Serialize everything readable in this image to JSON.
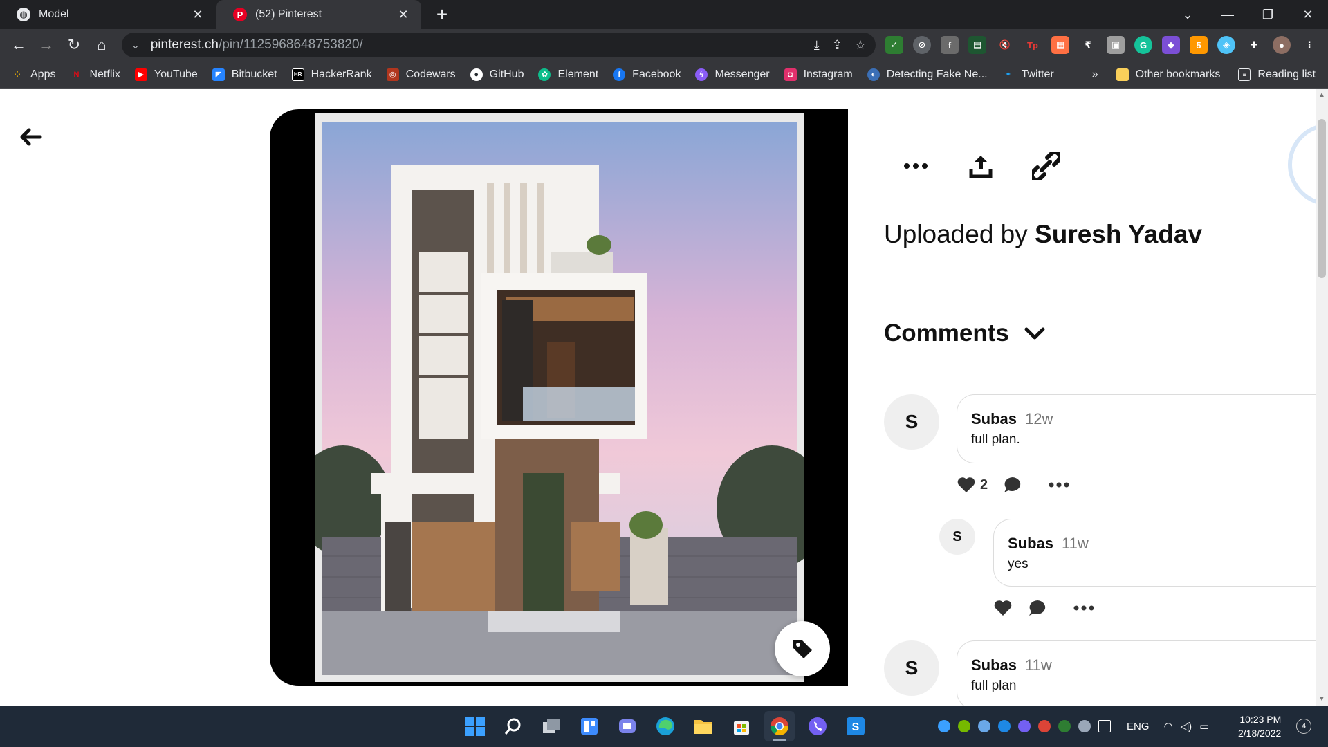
{
  "browser": {
    "tabs": [
      {
        "title": "Model",
        "active": false
      },
      {
        "title": "(52) Pinterest",
        "active": true
      }
    ],
    "address": {
      "domain": "pinterest.ch",
      "path": "/pin/1125968648753820/"
    },
    "bookmarks": [
      {
        "label": "Apps",
        "icon": "apps-grid-icon",
        "color": "#f4b400"
      },
      {
        "label": "Netflix",
        "icon": "netflix-icon",
        "color": "#e50914"
      },
      {
        "label": "YouTube",
        "icon": "youtube-icon",
        "color": "#ff0000"
      },
      {
        "label": "Bitbucket",
        "icon": "bitbucket-icon",
        "color": "#2684ff"
      },
      {
        "label": "HackerRank",
        "icon": "hackerrank-icon",
        "color": "#0e141e"
      },
      {
        "label": "Codewars",
        "icon": "codewars-icon",
        "color": "#b1361e"
      },
      {
        "label": "GitHub",
        "icon": "github-icon",
        "color": "#24292e"
      },
      {
        "label": "Element",
        "icon": "element-icon",
        "color": "#0dbd8b"
      },
      {
        "label": "Facebook",
        "icon": "facebook-icon",
        "color": "#1877f2"
      },
      {
        "label": "Messenger",
        "icon": "messenger-icon",
        "color": "#8a5cf6"
      },
      {
        "label": "Instagram",
        "icon": "instagram-icon",
        "color": "#e1306c"
      },
      {
        "label": "Detecting Fake Ne...",
        "icon": "page-icon",
        "color": "#3b6fb6"
      },
      {
        "label": "Twitter",
        "icon": "twitter-icon",
        "color": "#1da1f2"
      }
    ],
    "bookmarks_overflow": "»",
    "other_bookmarks": "Other bookmarks",
    "reading_list": "Reading list"
  },
  "pin": {
    "uploaded_prefix": "Uploaded by",
    "uploader": "Suresh Yadav",
    "comments_heading": "Comments",
    "comments": [
      {
        "initial": "S",
        "author": "Subas",
        "time": "12w",
        "text": "full plan.",
        "likes": "2",
        "reply": false
      },
      {
        "initial": "S",
        "author": "Subas",
        "time": "11w",
        "text": "yes",
        "likes": "",
        "reply": true
      },
      {
        "initial": "S",
        "author": "Subas",
        "time": "11w",
        "text": "full plan",
        "likes": "",
        "reply": false
      }
    ]
  },
  "taskbar": {
    "language": "ENG",
    "time": "10:23 PM",
    "date": "2/18/2022",
    "notifications": "4"
  },
  "colors": {
    "pinterest_red": "#e60023",
    "chrome_dark": "#202124",
    "taskbar": "#1f2a38"
  }
}
